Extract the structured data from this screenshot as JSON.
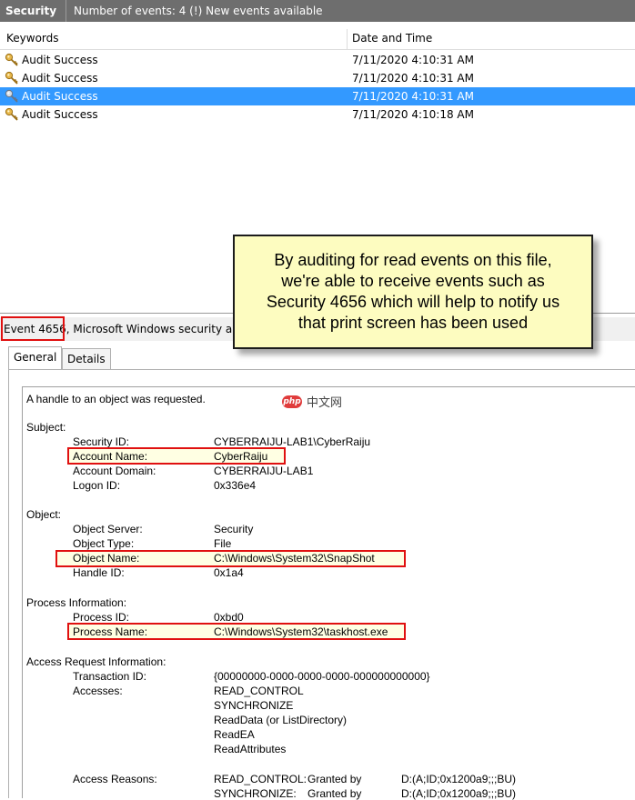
{
  "header": {
    "title": "Security",
    "count_text": "Number of events: 4 (!) New events available"
  },
  "columns": {
    "keywords": "Keywords",
    "datetime": "Date and Time"
  },
  "events": [
    {
      "keyword": "Audit Success",
      "datetime": "7/11/2020 4:10:31 AM"
    },
    {
      "keyword": "Audit Success",
      "datetime": "7/11/2020 4:10:31 AM"
    },
    {
      "keyword": "Audit Success",
      "datetime": "7/11/2020 4:10:31 AM"
    },
    {
      "keyword": "Audit Success",
      "datetime": "7/11/2020 4:10:18 AM"
    }
  ],
  "event_bar": {
    "event_id": "Event 4656,",
    "source_text": " Microsoft Windows security aud"
  },
  "tabs": {
    "general": "General",
    "details": "Details"
  },
  "callout": {
    "line1": "By auditing for read events on this file,",
    "line2": "we're able to receive events such as",
    "line3": "Security 4656 which will help to notify us",
    "line4": "that print screen has been used"
  },
  "watermark": {
    "badge": "php",
    "text": "中文网"
  },
  "details": {
    "intro": "A handle to an object was requested.",
    "subject_header": "Subject:",
    "security_id_label": "Security ID:",
    "security_id": "CYBERRAIJU-LAB1\\CyberRaiju",
    "account_name_label": "Account Name:",
    "account_name": "CyberRaiju",
    "account_domain_label": "Account Domain:",
    "account_domain": "CYBERRAIJU-LAB1",
    "logon_id_label": "Logon ID:",
    "logon_id": "0x336e4",
    "object_header": "Object:",
    "object_server_label": "Object Server:",
    "object_server": "Security",
    "object_type_label": "Object Type:",
    "object_type": "File",
    "object_name_label": "Object Name:",
    "object_name": "C:\\Windows\\System32\\SnapShot",
    "handle_id_label": "Handle ID:",
    "handle_id": "0x1a4",
    "process_header": "Process Information:",
    "process_id_label": "Process ID:",
    "process_id": "0xbd0",
    "process_name_label": "Process Name:",
    "process_name": "C:\\Windows\\System32\\taskhost.exe",
    "access_header": "Access Request Information:",
    "transaction_id_label": "Transaction ID:",
    "transaction_id": "{00000000-0000-0000-0000-000000000000}",
    "accesses_label": "Accesses:",
    "accesses": [
      "READ_CONTROL",
      "SYNCHRONIZE",
      "ReadData (or ListDirectory)",
      "ReadEA",
      "ReadAttributes"
    ],
    "access_reasons_label": "Access Reasons:",
    "reasons": [
      {
        "right": "READ_CONTROL:",
        "status": "Granted by",
        "sddl": "D:(A;ID;0x1200a9;;;BU)"
      },
      {
        "right": "SYNCHRONIZE:",
        "status": "Granted by",
        "sddl": "D:(A;ID;0x1200a9;;;BU)"
      }
    ]
  },
  "colors": {
    "selection": "#3399ff",
    "highlight_border": "#e01010",
    "callout_bg": "#fdfcc0",
    "topbar": "#6e6e6e"
  }
}
